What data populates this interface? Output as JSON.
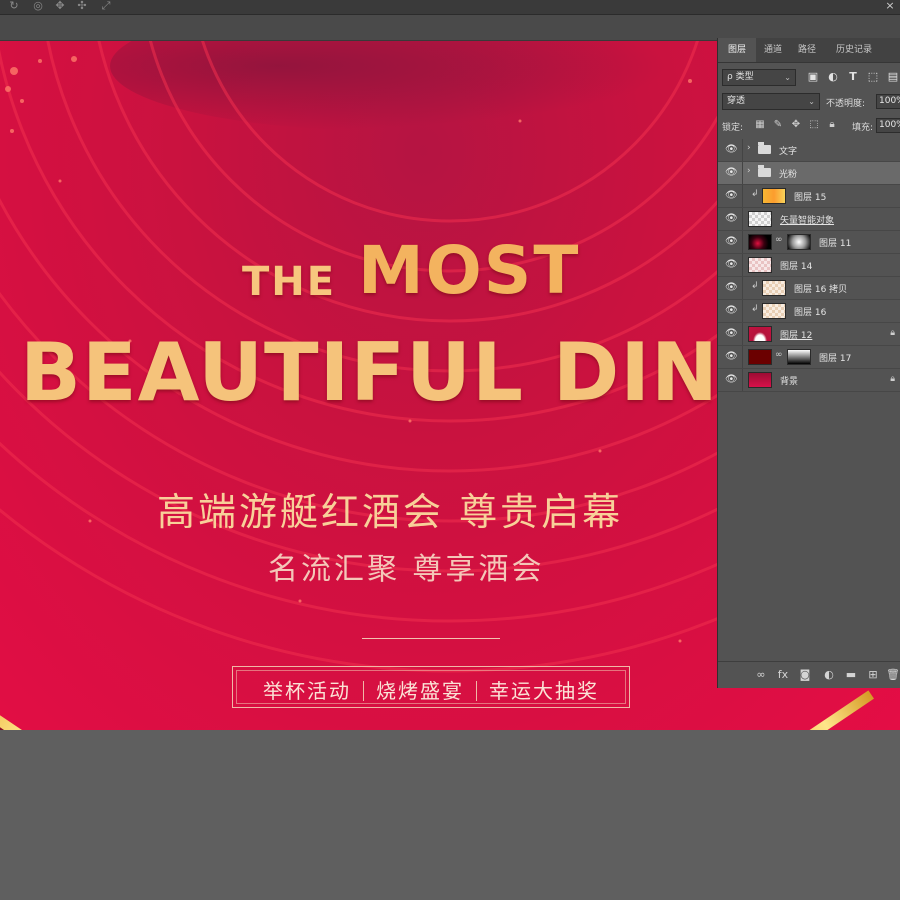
{
  "app": {
    "top_toolbar_icons": [
      "3d-rotate-icon",
      "3d-roll-icon",
      "3d-pan-icon",
      "3d-slide-icon",
      "3d-scale-icon"
    ]
  },
  "artwork": {
    "headline_the": "THE",
    "headline_most": "MOST",
    "headline_line2": "BEAUTIFUL DINN",
    "subtitle_1": "高端游艇红酒会  尊贵启幕",
    "subtitle_2": "名流汇聚  尊享酒会",
    "tags": [
      "举杯活动",
      "烧烤盛宴",
      "幸运大抽奖"
    ],
    "colors": {
      "background": "#d41041",
      "gold": "#f5c37b",
      "accent_gold": "#e9b43c"
    }
  },
  "layers_panel": {
    "tabs": [
      "图层",
      "通道",
      "路径",
      "历史记录"
    ],
    "active_tab": "图层",
    "kind_filter": "ρ 类型",
    "blend_mode": "穿透",
    "opacity_label": "不透明度:",
    "opacity_value": "100%",
    "lock_label": "锁定:",
    "fill_label": "填充:",
    "fill_value": "100%",
    "layers": [
      {
        "name": "文字",
        "type": "group"
      },
      {
        "name": "光粉",
        "type": "group",
        "selected": true
      },
      {
        "name": "图层 15",
        "type": "clipped"
      },
      {
        "name": "矢量智能对象",
        "type": "smart"
      },
      {
        "name": "图层 11",
        "type": "masked"
      },
      {
        "name": "图层 14",
        "type": "normal"
      },
      {
        "name": "图层 16 拷贝",
        "type": "clipped"
      },
      {
        "name": "图层 16",
        "type": "clipped"
      },
      {
        "name": "图层 12",
        "type": "normal",
        "locked": true
      },
      {
        "name": "图层 17",
        "type": "masked"
      },
      {
        "name": "背景",
        "type": "background",
        "locked": true
      }
    ]
  }
}
